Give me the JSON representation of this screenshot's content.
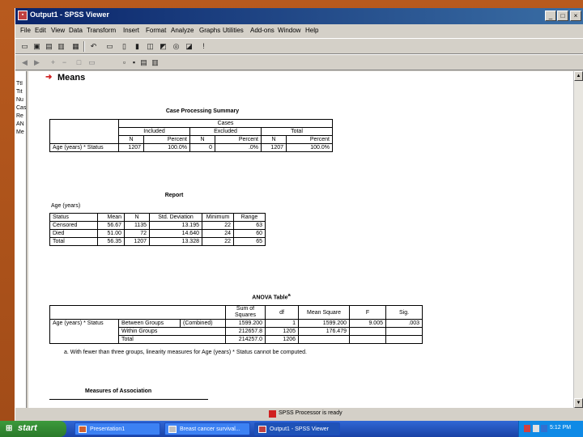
{
  "window": {
    "title": "Output1 - SPSS Viewer",
    "controls": {
      "minimize": "_",
      "maximize": "□",
      "close": "×"
    }
  },
  "menu": [
    "File",
    "Edit",
    "View",
    "Data",
    "Transform",
    "Insert",
    "Format",
    "Analyze",
    "Graphs",
    "Utilities",
    "Add-ons",
    "Window",
    "Help"
  ],
  "toolbar1_icons": [
    "open-icon",
    "save-icon",
    "print-icon",
    "print-preview-icon",
    "export-icon",
    "undo-icon",
    "goto-data-icon",
    "goto-case-icon",
    "variables-icon",
    "show-all-icon",
    "select-output-icon",
    "designate-window-icon",
    "insert-heading-icon",
    "help-icon"
  ],
  "toolbar2_icons": [
    "back-icon",
    "forward-icon",
    "promote-icon",
    "demote-icon",
    "expand-icon",
    "collapse-icon",
    "show-icon",
    "hide-icon",
    "insert-text-icon",
    "insert-title-icon"
  ],
  "outline_items": [
    "Ttl",
    "Tit",
    "Nu",
    "Cas",
    "Re",
    "AN",
    "Me"
  ],
  "section_title": "Means",
  "case_summary": {
    "caption": "Case Processing Summary",
    "group_header": "Cases",
    "sub_headers": [
      "Included",
      "Excluded",
      "Total"
    ],
    "col_headers": [
      "N",
      "Percent",
      "N",
      "Percent",
      "N",
      "Percent"
    ],
    "row_label": "Age (years) * Status",
    "values": [
      "1207",
      "100.0%",
      "0",
      ".0%",
      "1207",
      "100.0%"
    ]
  },
  "report": {
    "caption": "Report",
    "subtitle": "Age (years)",
    "headers": [
      "Status",
      "Mean",
      "N",
      "Std. Deviation",
      "Minimum",
      "Range"
    ],
    "rows": [
      [
        "Censored",
        "56.67",
        "1135",
        "13.195",
        "22",
        "63"
      ],
      [
        "Died",
        "51.00",
        "72",
        "14.640",
        "24",
        "60"
      ],
      [
        "Total",
        "56.35",
        "1207",
        "13.328",
        "22",
        "65"
      ]
    ]
  },
  "anova": {
    "caption": "ANOVA Table",
    "caption_sup": "a",
    "headers": [
      "Sum of Squares",
      "df",
      "Mean Square",
      "F",
      "Sig."
    ],
    "row_label": "Age (years) * Status",
    "between_label": "Between Groups",
    "combined_label": "(Combined)",
    "within_label": "Within Groups",
    "total_label": "Total",
    "between": [
      "1599.200",
      "1",
      "1599.200",
      "9.005",
      ".003"
    ],
    "within": [
      "212657.8",
      "1205",
      "176.479"
    ],
    "total": [
      "214257.0",
      "1206"
    ],
    "footnote": "a. With fewer than three groups, linearity measures for Age (years) * Status cannot be computed."
  },
  "measures_caption": "Measures of Association",
  "status_bar": "SPSS Processor is ready",
  "taskbar": {
    "start_label": "start",
    "tasks": [
      "Presentation1",
      "Breast cancer survival...",
      "Output1 - SPSS Viewer"
    ],
    "clock": "5:12 PM"
  }
}
